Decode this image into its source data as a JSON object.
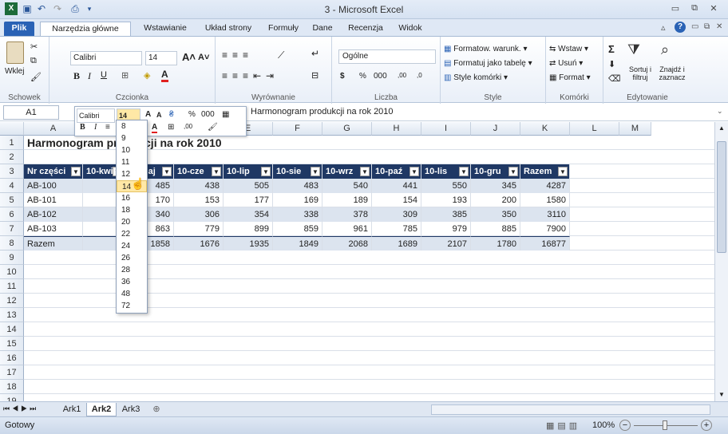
{
  "window": {
    "title": "3 - Microsoft Excel",
    "minimize": "▭",
    "restore": "⧉",
    "close": "✕"
  },
  "qat": [
    "excel-logo-icon",
    "save-icon",
    "undo-icon",
    "redo-icon",
    "print-preview-icon",
    "customize-qat-icon"
  ],
  "tabs": [
    "Plik",
    "Narzędzia główne",
    "Wstawianie",
    "Układ strony",
    "Formuły",
    "Dane",
    "Recenzja",
    "Widok"
  ],
  "ribbon": {
    "clipboard": {
      "label": "Schowek",
      "paste": "Wklej"
    },
    "font": {
      "label": "Czcionka",
      "name": "Calibri",
      "size": "14",
      "bold": "B",
      "italic": "I",
      "underline": "U"
    },
    "alignment": {
      "label": "Wyrównanie"
    },
    "number": {
      "label": "Liczba",
      "format": "Ogólne",
      "currency": "$",
      "percent": "%",
      "thousands": "000",
      "inc": ",00",
      "dec": ",0"
    },
    "styles": {
      "label": "Style",
      "cond": "Formatow. warunk.",
      "table": "Formatuj jako tabelę",
      "cell": "Style komórki"
    },
    "cells": {
      "label": "Komórki",
      "insert": "Wstaw",
      "delete": "Usuń",
      "format": "Format"
    },
    "editing": {
      "label": "Edytowanie",
      "sort": "Sortuj i filtruj",
      "find": "Znajdź i zaznacz",
      "sigma": "Σ"
    }
  },
  "formula": {
    "namebox": "A1",
    "fx": "fx",
    "content": "Harmonogram produkcji na rok 2010"
  },
  "columns": [
    "A",
    "B",
    "C",
    "D",
    "E",
    "F",
    "G",
    "H",
    "I",
    "J",
    "K",
    "L",
    "M"
  ],
  "rows": [
    "1",
    "2",
    "3",
    "4",
    "5",
    "6",
    "7",
    "8",
    "9",
    "10",
    "11",
    "12",
    "13",
    "14",
    "15",
    "16",
    "17",
    "18",
    "19"
  ],
  "sheet": {
    "title": "Harmonogram produkcji na rok 2010",
    "headers": [
      "Nr części",
      "10-kwi",
      "10-maj",
      "10-cze",
      "10-lip",
      "10-sie",
      "10-wrz",
      "10-paź",
      "10-lis",
      "10-gru",
      "Razem"
    ],
    "data": [
      [
        "AB-100",
        "",
        "485",
        "438",
        "505",
        "483",
        "540",
        "441",
        "550",
        "345",
        "4287"
      ],
      [
        "AB-101",
        "",
        "170",
        "153",
        "177",
        "169",
        "189",
        "154",
        "193",
        "200",
        "1580"
      ],
      [
        "AB-102",
        "",
        "340",
        "306",
        "354",
        "338",
        "378",
        "309",
        "385",
        "350",
        "3110"
      ],
      [
        "AB-103",
        "",
        "863",
        "779",
        "899",
        "859",
        "961",
        "785",
        "979",
        "885",
        "7900"
      ],
      [
        "Razem",
        "1",
        "1858",
        "1676",
        "1935",
        "1849",
        "2068",
        "1689",
        "2107",
        "1780",
        "16877"
      ]
    ]
  },
  "mini_toolbar": {
    "font": "Calibri",
    "size": "14",
    "grow": "A",
    "shrink": "A",
    "percent": "%",
    "thousands": "000",
    "bold": "B",
    "italic": "I"
  },
  "font_sizes": [
    "8",
    "9",
    "10",
    "11",
    "12",
    "14",
    "16",
    "18",
    "20",
    "22",
    "24",
    "26",
    "28",
    "36",
    "48",
    "72"
  ],
  "font_sizes_selected": "14",
  "sheet_tabs": [
    "Ark1",
    "Ark2",
    "Ark3"
  ],
  "active_sheet": "Ark2",
  "status": {
    "ready": "Gotowy",
    "zoom": "100%",
    "zoom_minus": "−",
    "zoom_plus": "+"
  }
}
